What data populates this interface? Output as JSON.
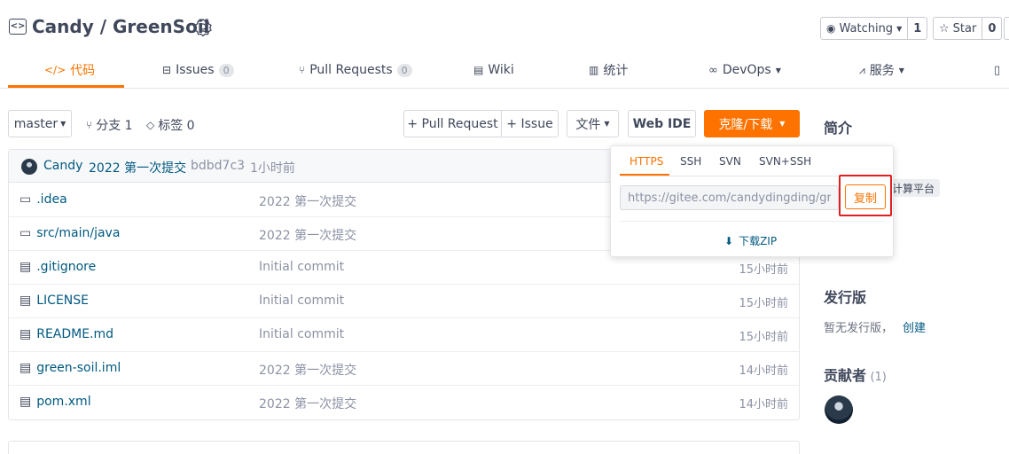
{
  "header": {
    "owner": "Candy",
    "separator": "/",
    "repo": "GreenSoil",
    "watch_label": "Watching",
    "watch_count": "1",
    "star_label": "Star",
    "star_count": "0"
  },
  "tabs": [
    {
      "label": "代码",
      "icon": "code-icon",
      "active": true
    },
    {
      "label": "Issues",
      "count": "0",
      "icon": "issues-icon"
    },
    {
      "label": "Pull Requests",
      "count": "0",
      "icon": "pull-request-icon"
    },
    {
      "label": "Wiki",
      "icon": "wiki-icon"
    },
    {
      "label": "统计",
      "icon": "stats-icon"
    },
    {
      "label": "DevOps",
      "icon": "devops-icon",
      "dropdown": true
    },
    {
      "label": "服务",
      "icon": "service-icon",
      "dropdown": true
    }
  ],
  "toolbar": {
    "branch": "master",
    "branches_label": "分支 1",
    "tags_label": "标签 0",
    "pull_request_btn": "+ Pull Request",
    "issue_btn": "+ Issue",
    "file_btn": "文件",
    "webide_btn": "Web IDE",
    "clone_btn": "克隆/下载"
  },
  "commit": {
    "author": "Candy",
    "message": "2022 第一次提交",
    "hash": "bdbd7c3",
    "time": "1小时前"
  },
  "files": [
    {
      "name": ".idea",
      "type": "folder",
      "message": "2022 第一次提交",
      "time": ""
    },
    {
      "name": "src/main/java",
      "type": "folder",
      "message": "2022 第一次提交",
      "time": ""
    },
    {
      "name": ".gitignore",
      "type": "file",
      "message": "Initial commit",
      "time": "15小时前"
    },
    {
      "name": "LICENSE",
      "type": "file",
      "message": "Initial commit",
      "time": "15小时前"
    },
    {
      "name": "README.md",
      "type": "file",
      "message": "Initial commit",
      "time": "15小时前"
    },
    {
      "name": "green-soil.iml",
      "type": "file",
      "message": "2022 第一次提交",
      "time": "14小时前"
    },
    {
      "name": "pom.xml",
      "type": "file",
      "message": "2022 第一次提交",
      "time": "14小时前"
    }
  ],
  "clone_popup": {
    "tabs": [
      "HTTPS",
      "SSH",
      "SVN",
      "SVN+SSH"
    ],
    "active_tab": "HTTPS",
    "url": "https://gitee.com/candydingding/green-soil.git",
    "copy_label": "复制",
    "download_label": "下载ZIP"
  },
  "sidebar": {
    "intro_title": "简介",
    "tag_chip": "计算平台",
    "releases_title": "发行版",
    "releases_text": "暂无发行版，",
    "releases_create": "创建",
    "contributors_title": "贡献者",
    "contributors_count": "(1)"
  },
  "colors": {
    "accent": "#fe7300",
    "link": "#005980",
    "highlight_border": "#e02020"
  }
}
